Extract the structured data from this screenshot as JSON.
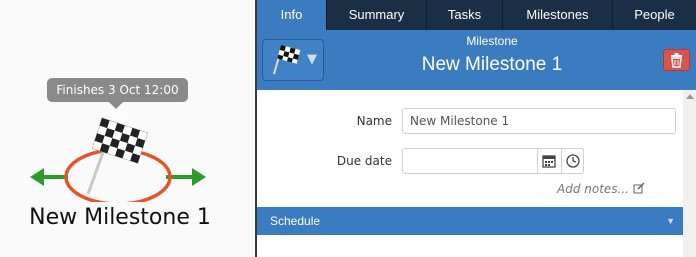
{
  "canvas": {
    "tooltip": "Finishes 3 Oct 12:00 am",
    "milestone_label": "New Milestone 1"
  },
  "tabs": [
    "Info",
    "Summary",
    "Tasks",
    "Milestones",
    "People"
  ],
  "active_tab": "Info",
  "header": {
    "type_label": "Milestone",
    "name": "New Milestone 1",
    "icon": "checkered-flag-icon",
    "delete_icon": "trash-icon"
  },
  "form": {
    "name_label": "Name",
    "name_value": "New Milestone 1",
    "due_label": "Due date",
    "due_value": "",
    "add_notes": "Add notes..."
  },
  "schedule": {
    "label": "Schedule"
  },
  "colors": {
    "accent": "#3b7bbf",
    "tab_bar": "#1a2f46",
    "delete": "#d9534f",
    "arrow": "#2e9a2e",
    "ring": "#e2562a"
  }
}
